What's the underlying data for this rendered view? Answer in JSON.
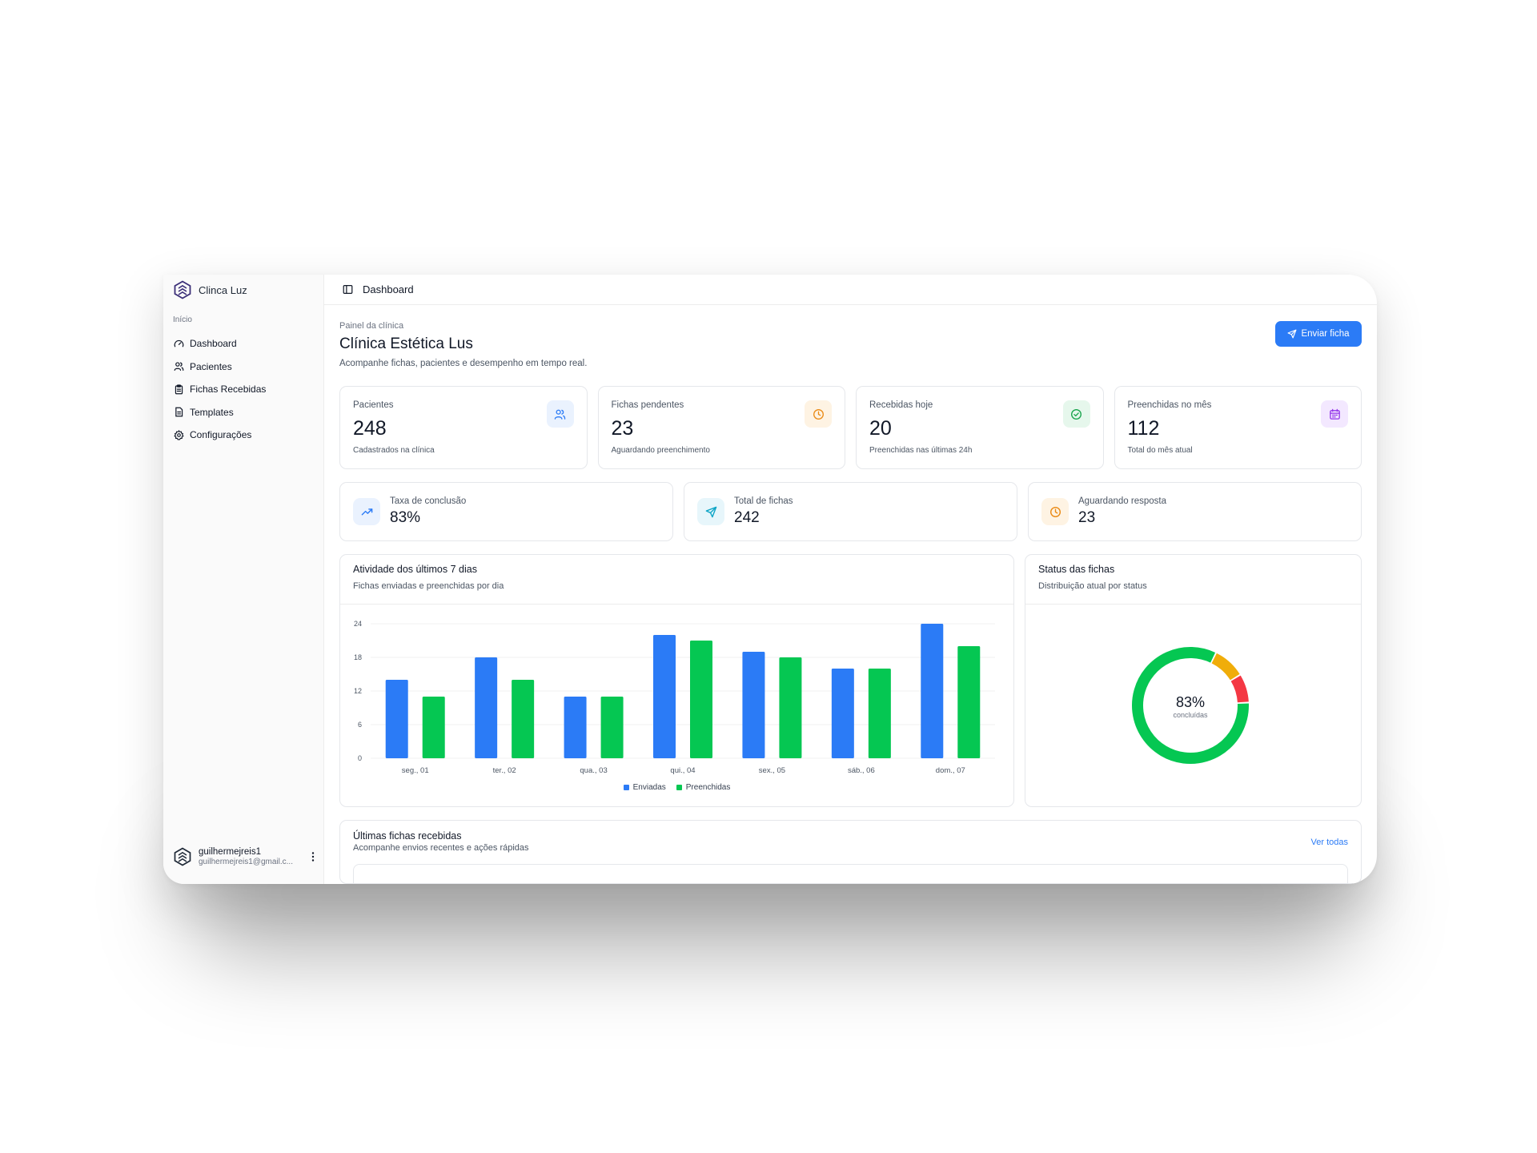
{
  "app": {
    "name": "Clinca Luz",
    "section_label": "Início"
  },
  "sidebar": {
    "items": [
      {
        "label": "Dashboard",
        "icon": "gauge-icon"
      },
      {
        "label": "Pacientes",
        "icon": "users-icon"
      },
      {
        "label": "Fichas Recebidas",
        "icon": "clipboard-icon"
      },
      {
        "label": "Templates",
        "icon": "file-text-icon"
      },
      {
        "label": "Configurações",
        "icon": "gear-icon"
      }
    ],
    "user": {
      "name": "guilhermejreis1",
      "email": "guilhermejreis1@gmail.c..."
    }
  },
  "topbar": {
    "title": "Dashboard"
  },
  "header": {
    "eyebrow": "Painel da clínica",
    "title": "Clínica Estética Lus",
    "subtitle": "Acompanhe fichas, pacientes e desempenho em tempo real.",
    "primary_action": "Enviar ficha"
  },
  "kpis": [
    {
      "label": "Pacientes",
      "value": "248",
      "hint": "Cadastrados na clínica",
      "icon": "users-icon",
      "color": "#2b7bf6",
      "bg": "#eaf2fe"
    },
    {
      "label": "Fichas pendentes",
      "value": "23",
      "hint": "Aguardando preenchimento",
      "icon": "clock-icon",
      "color": "#ea8a14",
      "bg": "#fef3e3"
    },
    {
      "label": "Recebidas hoje",
      "value": "20",
      "hint": "Preenchidas nas últimas 24h",
      "icon": "check-circle-icon",
      "color": "#16a34a",
      "bg": "#e6f7ec"
    },
    {
      "label": "Preenchidas no mês",
      "value": "112",
      "hint": "Total do mês atual",
      "icon": "calendar-icon",
      "color": "#9333ea",
      "bg": "#f3e8ff"
    }
  ],
  "stats": [
    {
      "label": "Taxa de conclusão",
      "value": "83%",
      "icon": "trending-up-icon",
      "color": "#2b7bf6",
      "bg": "#eaf2fe"
    },
    {
      "label": "Total de fichas",
      "value": "242",
      "icon": "send-icon",
      "color": "#0ea5c6",
      "bg": "#e7f6fb"
    },
    {
      "label": "Aguardando resposta",
      "value": "23",
      "icon": "clock-icon",
      "color": "#ea8a14",
      "bg": "#fef3e3"
    }
  ],
  "activity_card": {
    "title": "Atividade dos últimos 7 dias",
    "subtitle": "Fichas enviadas e preenchidas por dia"
  },
  "status_card": {
    "title": "Status das fichas",
    "subtitle": "Distribuição atual por status",
    "center_value": "83%",
    "center_label": "concluídas"
  },
  "recent": {
    "title": "Últimas fichas recebidas",
    "subtitle": "Acompanhe envios recentes e ações rápidas",
    "link": "Ver todas"
  },
  "chart_data": [
    {
      "type": "bar",
      "title": "Atividade dos últimos 7 dias",
      "categories": [
        "seg., 01",
        "ter., 02",
        "qua., 03",
        "qui., 04",
        "sex., 05",
        "sáb., 06",
        "dom., 07"
      ],
      "series": [
        {
          "name": "Enviadas",
          "color": "#2b7bf6",
          "values": [
            14,
            18,
            11,
            22,
            19,
            16,
            24
          ]
        },
        {
          "name": "Preenchidas",
          "color": "#05c752",
          "values": [
            11,
            14,
            11,
            21,
            18,
            16,
            20
          ]
        }
      ],
      "yticks": [
        0,
        6,
        12,
        18,
        24
      ],
      "ylim": [
        0,
        24
      ],
      "grid": true,
      "legend": "bottom-center"
    },
    {
      "type": "pie",
      "title": "Status das fichas",
      "slices": [
        {
          "label": "concluídas",
          "value": 83,
          "color": "#05c752"
        },
        {
          "value": 9,
          "color": "#f0ad0a"
        },
        {
          "value": 8,
          "color": "#f43743"
        }
      ]
    }
  ]
}
